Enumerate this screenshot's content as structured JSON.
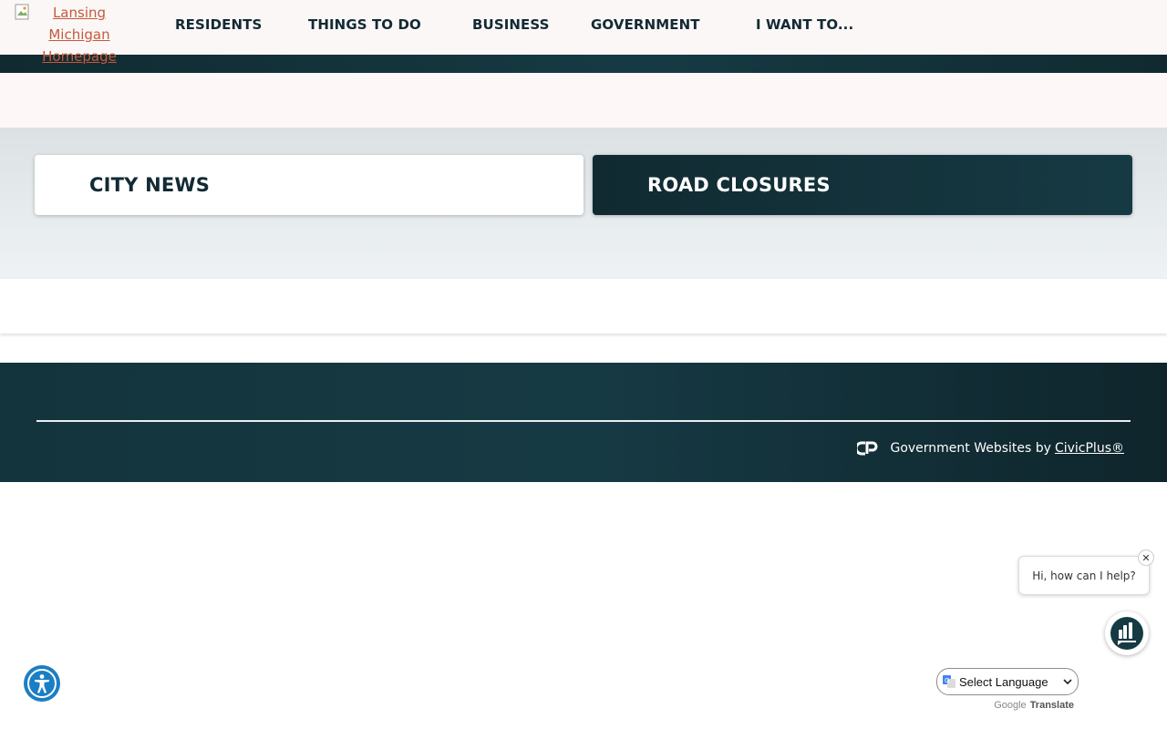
{
  "header": {
    "logo_alt": "Lansing Michigan Homepage",
    "nav": [
      {
        "label": "RESIDENTS"
      },
      {
        "label": "THINGS TO DO"
      },
      {
        "label": "BUSINESS"
      },
      {
        "label": "GOVERNMENT"
      },
      {
        "label": "I WANT TO..."
      }
    ]
  },
  "tabs": [
    {
      "label": "CITY NEWS",
      "active": true
    },
    {
      "label": "ROAD CLOSURES",
      "active": false
    }
  ],
  "footer": {
    "credit_text": "Government Websites by",
    "credit_link": "CivicPlus®"
  },
  "chat": {
    "greeting": "Hi, how can I help?",
    "close_glyph": "✕"
  },
  "translate": {
    "select_label": "Select Language",
    "powered_by_google": "Google",
    "powered_by_translate": "Translate"
  },
  "colors": {
    "brand_dark": "#163a44",
    "logo_link": "#c45a3a",
    "accessibility_blue": "#1a7ec4"
  },
  "icons": {
    "accessibility": "accessibility-person-icon",
    "chat": "chat-bars-icon",
    "civicplus": "civicplus-logo-icon",
    "google_translate": "google-translate-icon"
  }
}
